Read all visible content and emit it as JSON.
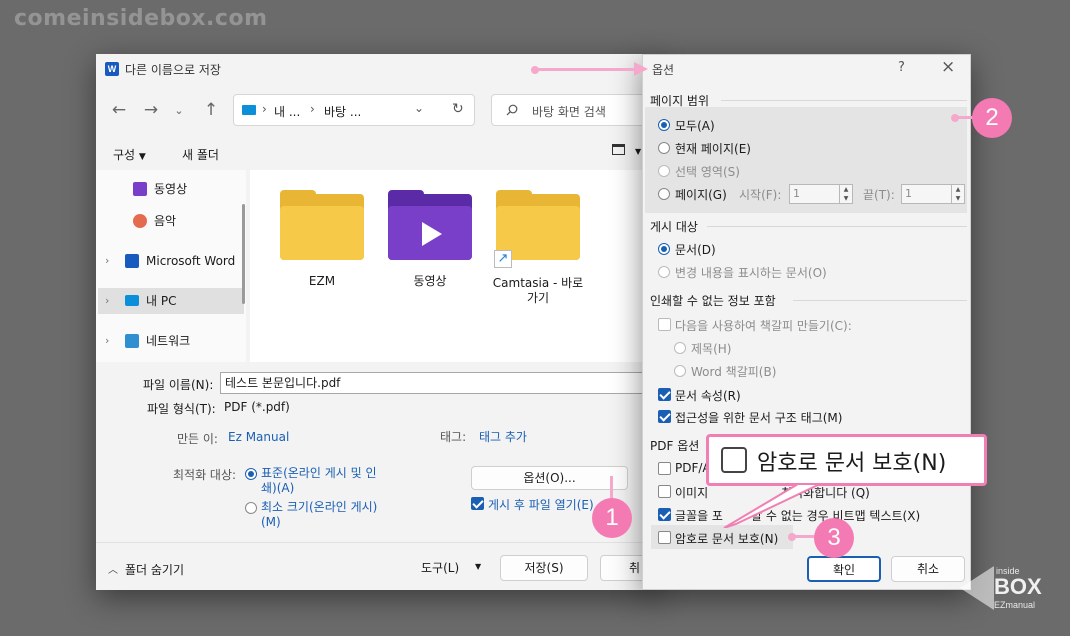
{
  "watermark": "comeinsidebox.com",
  "save_dialog": {
    "title": "다른 이름으로 저장",
    "app_icon_letter": "W",
    "address": [
      "내 ...",
      "바탕 ..."
    ],
    "search_placeholder": "바탕 화면 검색",
    "toolbar": {
      "organize": "구성",
      "new_folder": "새 폴더"
    },
    "sidebar": [
      {
        "label": "동영상"
      },
      {
        "label": "음악"
      },
      {
        "label": "Microsoft Word"
      },
      {
        "label": "내 PC"
      },
      {
        "label": "네트워크"
      }
    ],
    "folders": [
      {
        "label": "EZM"
      },
      {
        "label": "동영상"
      },
      {
        "label": "Camtasia - 바로 가기"
      }
    ],
    "filename_label": "파일 이름(N):",
    "filename_value": "테스트 본문입니다.pdf",
    "filetype_label": "파일 형식(T):",
    "filetype_value": "PDF (*.pdf)",
    "author_label": "만든 이:",
    "author_value": "Ez Manual",
    "tags_label": "태그:",
    "tags_value": "태그 추가",
    "optimize_label": "최적화 대상:",
    "optimize_standard": "표준(온라인 게시 및 인쇄)(A)",
    "optimize_minimum": "최소 크기(온라인 게시)(M)",
    "options_button": "옵션(O)...",
    "open_after_publish": "게시 후 파일 열기(E)",
    "hide_folders": "폴더 숨기기",
    "tools": "도구(L)",
    "save_button": "저장(S)",
    "cancel_button_partial": "취"
  },
  "options_dialog": {
    "title": "옵션",
    "help": "?",
    "page_range_section": "페이지 범위",
    "all": "모두(A)",
    "current_page": "현재 페이지(E)",
    "selection": "선택 영역(S)",
    "pages": "페이지(G)",
    "from_label": "시작(F):",
    "from_value": "1",
    "to_label": "끝(T):",
    "to_value": "1",
    "publish_section": "게시 대상",
    "document": "문서(D)",
    "document_markup": "변경 내용을 표시하는 문서(O)",
    "non_print_section": "인쇄할 수 없는 정보 포함",
    "create_bookmarks": "다음을 사용하여 책갈피 만들기(C):",
    "headings": "제목(H)",
    "word_bookmarks": "Word 책갈피(B)",
    "doc_properties": "문서 속성(R)",
    "doc_structure_tags": "접근성을 위한 문서 구조 태그(M)",
    "pdf_options_section": "PDF 옵션",
    "pdfa_partial": "PDF/A",
    "bitmap_images_left": "이미지",
    "bitmap_images_right": "최적화합니다 (Q)",
    "bitmap_text_left": "글꼴을 포",
    "bitmap_text_right": "할 수 없는 경우 비트맵 텍스트(X)",
    "encrypt": "암호로 문서 보호(N)",
    "ok": "확인",
    "cancel": "취소"
  },
  "callout": {
    "label": "암호로 문서 보호(N)"
  },
  "badges": [
    "1",
    "2",
    "3"
  ],
  "logo": {
    "line1": "inside",
    "line2": "BOX",
    "line3": "EZmanual"
  },
  "colors": {
    "accent": "#1a5fb4",
    "annotation_pink": "#f47ab3",
    "folder_yellow": "#f7c948",
    "video_purple": "#7a3fc9"
  }
}
